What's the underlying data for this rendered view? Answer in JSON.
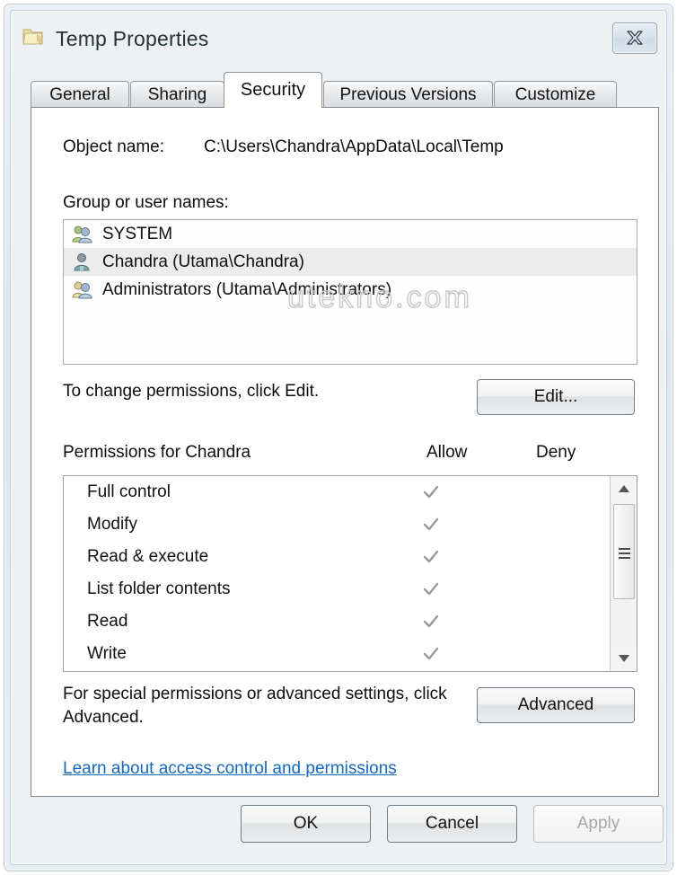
{
  "window": {
    "title": "Temp Properties",
    "icon": "folder-icon",
    "close_label": "Close"
  },
  "tabs": [
    {
      "label": "General",
      "active": false
    },
    {
      "label": "Sharing",
      "active": false
    },
    {
      "label": "Security",
      "active": true
    },
    {
      "label": "Previous Versions",
      "active": false
    },
    {
      "label": "Customize",
      "active": false
    }
  ],
  "security": {
    "object_name_label": "Object name:",
    "object_name_value": "C:\\Users\\Chandra\\AppData\\Local\\Temp",
    "group_label": "Group or user names:",
    "users": [
      {
        "name": "SYSTEM",
        "icon": "group-users-icon",
        "selected": false
      },
      {
        "name": "Chandra (Utama\\Chandra)",
        "icon": "single-user-icon",
        "selected": true
      },
      {
        "name": "Administrators (Utama\\Administrators)",
        "icon": "group-users-icon",
        "selected": false
      }
    ],
    "change_permissions_text": "To change permissions, click Edit.",
    "edit_button": "Edit...",
    "permissions_title": "Permissions for Chandra",
    "allow_header": "Allow",
    "deny_header": "Deny",
    "permissions": [
      {
        "name": "Full control",
        "allow": true,
        "deny": false
      },
      {
        "name": "Modify",
        "allow": true,
        "deny": false
      },
      {
        "name": "Read & execute",
        "allow": true,
        "deny": false
      },
      {
        "name": "List folder contents",
        "allow": true,
        "deny": false
      },
      {
        "name": "Read",
        "allow": true,
        "deny": false
      },
      {
        "name": "Write",
        "allow": true,
        "deny": false
      }
    ],
    "advanced_text": "For special permissions or advanced settings, click Advanced.",
    "advanced_button": "Advanced",
    "learn_link": "Learn about access control and permissions"
  },
  "footer": {
    "ok": "OK",
    "cancel": "Cancel",
    "apply": "Apply",
    "apply_disabled": true
  },
  "watermark": "utekno.com",
  "colors": {
    "link": "#1568c0",
    "check": "#9a9a9a",
    "selection": "#ececed"
  }
}
